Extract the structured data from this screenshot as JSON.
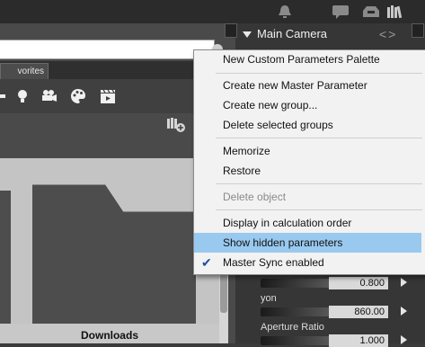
{
  "panel": {
    "title": "Main Camera",
    "nav": "<>"
  },
  "left": {
    "tab_label": "vorites",
    "footer_label": "Downloads"
  },
  "params": [
    {
      "label": "",
      "value": "0.800"
    },
    {
      "label": "yon",
      "value": "860.00"
    },
    {
      "label": "Aperture Ratio",
      "value": "1.000"
    }
  ],
  "menu": {
    "items": [
      {
        "label": "New Custom Parameters Palette",
        "enabled": true
      },
      {
        "label": "Create new Master Parameter",
        "enabled": true
      },
      {
        "label": "Create new group...",
        "enabled": true
      },
      {
        "label": "Delete selected groups",
        "enabled": true
      },
      {
        "label": "Memorize",
        "enabled": true
      },
      {
        "label": "Restore",
        "enabled": true
      },
      {
        "label": "Delete object",
        "enabled": false
      },
      {
        "label": "Display in calculation order",
        "enabled": true
      },
      {
        "label": "Show hidden parameters",
        "enabled": true,
        "highlighted": true
      },
      {
        "label": "Master Sync enabled",
        "enabled": true,
        "checked": true
      }
    ]
  },
  "colors": {
    "highlight": "#99c9ef",
    "check": "#1f4ea3"
  }
}
